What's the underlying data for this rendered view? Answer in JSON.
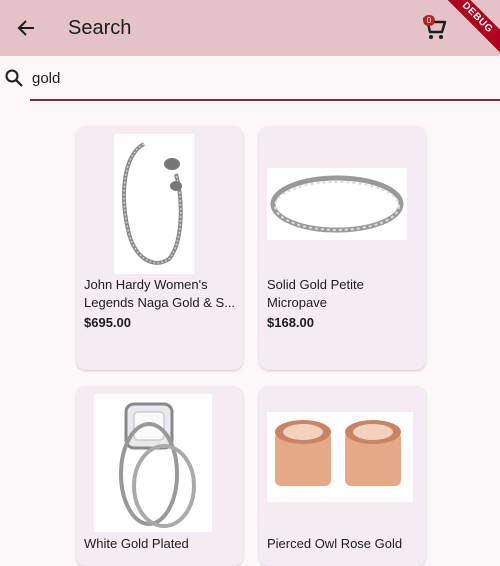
{
  "appbar": {
    "title": "Search",
    "cart_count": "0",
    "debug_label": "DEBUG"
  },
  "search": {
    "query": "gold"
  },
  "products": [
    {
      "name_line1": "John Hardy Women's",
      "name_line2": "Legends Naga Gold & S...",
      "price": "$695.00",
      "image": "bracelet-image"
    },
    {
      "name_line1": "Solid Gold Petite",
      "name_line2": "Micropave",
      "price": "$168.00",
      "image": "ring-band-image"
    },
    {
      "name_line1": "White Gold Plated",
      "name_line2": "",
      "price": "",
      "image": "diamond-ring-image"
    },
    {
      "name_line1": "Pierced Owl Rose Gold",
      "name_line2": "",
      "price": "",
      "image": "rose-gold-plugs-image"
    }
  ]
}
